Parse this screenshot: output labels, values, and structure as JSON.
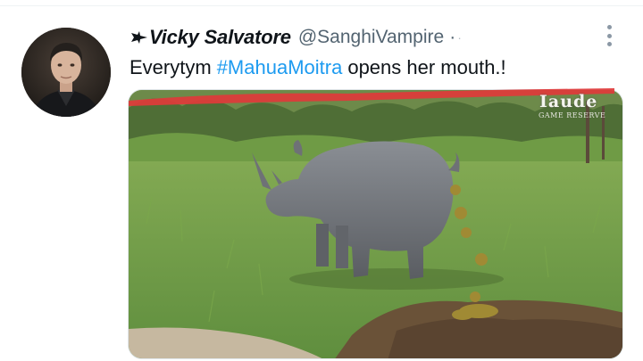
{
  "tweet": {
    "display_name": "Vicky Salvatore",
    "handle": "@SanghiVampire",
    "separator": "·",
    "text_before": "Everytym",
    "hashtag": "#MahuaMoitra",
    "text_after": "opens her mouth.!",
    "media": {
      "watermark": "Iaude",
      "watermark_sub": "GAME RESERVE",
      "annotation_color": "#e03a3a"
    }
  },
  "icons": {
    "name_prefix": "bat-icon",
    "menu": "more-vertical-icon"
  },
  "colors": {
    "hashtag": "#1d9bf0",
    "secondary_text": "#536471",
    "primary_text": "#0f1419"
  }
}
